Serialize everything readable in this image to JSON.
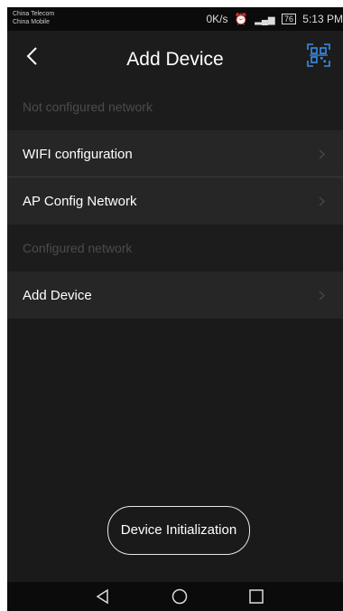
{
  "status_bar": {
    "carrier_1": "China Telecom",
    "carrier_2": "China Mobile",
    "net_speed": "0K/s",
    "battery": "76",
    "time": "5:13 PM"
  },
  "header": {
    "title": "Add Device",
    "back_icon": "chevron-left-icon",
    "scan_icon": "qr-scan-icon"
  },
  "sections": {
    "not_configured_label": "Not configured network",
    "configured_label": "Configured network"
  },
  "items": {
    "wifi_config": "WIFI configuration",
    "ap_config": "AP Config Network",
    "add_device": "Add Device"
  },
  "buttons": {
    "device_init": "Device Initialization"
  },
  "nav": {
    "back": "triangle-back-icon",
    "home": "circle-home-icon",
    "recents": "square-recents-icon"
  },
  "colors": {
    "background": "#1a1a1a",
    "row": "#262626",
    "section_text": "#4c4c4c",
    "accent_scan": "#3a8ee6"
  }
}
